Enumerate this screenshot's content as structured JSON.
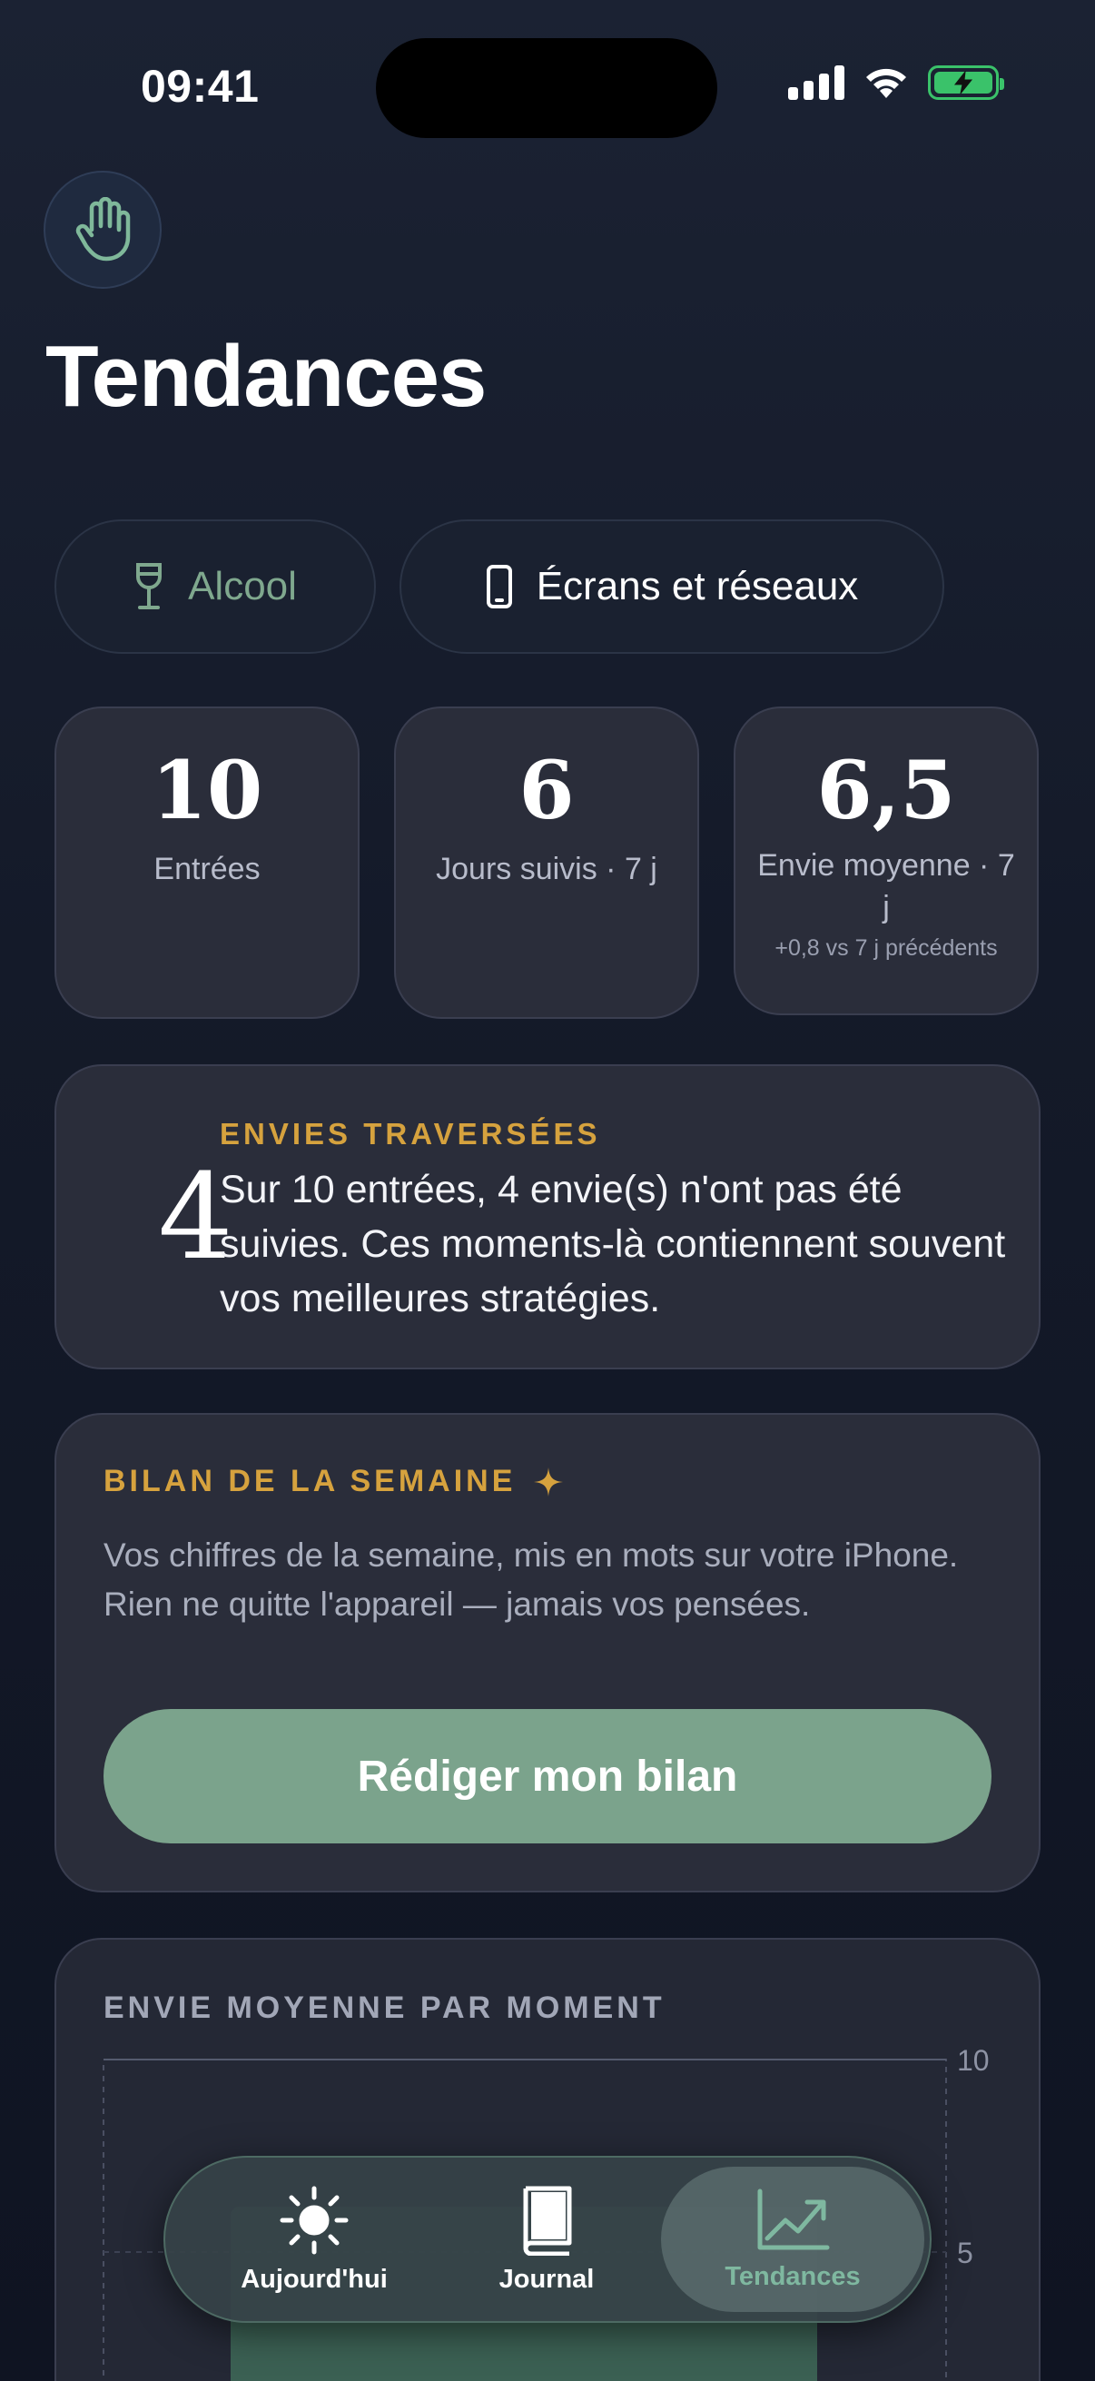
{
  "status_bar": {
    "time": "09:41"
  },
  "header": {
    "title": "Tendances",
    "hand_icon": "hand-raised-icon"
  },
  "filters": [
    {
      "label": "Alcool",
      "icon": "wine-glass-icon",
      "selected": true
    },
    {
      "label": "Écrans et réseaux",
      "icon": "smartphone-icon",
      "selected": false
    }
  ],
  "stats": [
    {
      "value": "10",
      "label": "Entrées"
    },
    {
      "value": "6",
      "label": "Jours suivis · 7 j"
    },
    {
      "value": "6,5",
      "label": "Envie moyenne · 7 j",
      "sub": "+0,8 vs 7 j précédents"
    }
  ],
  "envies": {
    "count": "4",
    "kicker": "ENVIES TRAVERSÉES",
    "text": "Sur 10 entrées, 4 envie(s) n'ont pas été suivies. Ces moments-là contiennent souvent vos meilleures stratégies."
  },
  "bilan": {
    "kicker": "BILAN DE LA SEMAINE",
    "text": "Vos chiffres de la semaine, mis en mots sur votre iPhone. Rien ne quitte l'appareil — jamais vos pensées.",
    "button": "Rédiger mon bilan"
  },
  "chart_card": {
    "kicker": "ENVIE MOYENNE PAR MOMENT"
  },
  "chart_data": {
    "type": "bar",
    "title": "ENVIE MOYENNE PAR MOMENT",
    "ylim": [
      0,
      10
    ],
    "yticks": [
      "10",
      "5"
    ],
    "categories": [],
    "values": []
  },
  "tabbar": {
    "tabs": [
      {
        "label": "Aujourd'hui",
        "icon": "sun-icon"
      },
      {
        "label": "Journal",
        "icon": "book-icon"
      },
      {
        "label": "Tendances",
        "icon": "chart-trend-icon",
        "active": true
      }
    ]
  },
  "colors": {
    "accent_green": "#7ba38c",
    "accent_gold": "#d6a23e",
    "battery": "#3ac26a"
  }
}
